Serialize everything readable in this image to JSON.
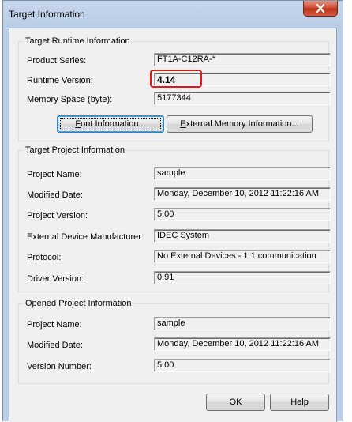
{
  "window": {
    "title": "Target Information",
    "close_glyph": "x"
  },
  "runtime_group": {
    "title": "Target Runtime Information",
    "product_series_label": "Product Series:",
    "product_series_value": "FT1A-C12RA-*",
    "runtime_version_label": "Runtime Version:",
    "runtime_version_value": "4.14",
    "memory_space_label": "Memory Space (byte):",
    "memory_space_value": "5177344",
    "font_button_underline": "F",
    "font_button_rest": "ont Information...",
    "external_memory_button_underline": "E",
    "external_memory_button_rest": "xternal Memory Information..."
  },
  "project_group": {
    "title": "Target Project Information",
    "project_name_label": "Project Name:",
    "project_name_value": "sample",
    "modified_date_label": "Modified Date:",
    "modified_date_value": "Monday, December 10, 2012 11:22:16 AM",
    "project_version_label": "Project Version:",
    "project_version_value": "5.00",
    "manufacturer_label": "External Device Manufacturer:",
    "manufacturer_value": "IDEC System",
    "protocol_label": "Protocol:",
    "protocol_value": "No External Devices - 1:1 communication",
    "driver_version_label": "Driver Version:",
    "driver_version_value": "0.91"
  },
  "opened_group": {
    "title": "Opened Project Information",
    "project_name_label": "Project Name:",
    "project_name_value": "sample",
    "modified_date_label": "Modified Date:",
    "modified_date_value": "Monday, December 10, 2012 11:22:16 AM",
    "version_number_label": "Version Number:",
    "version_number_value": "5.00"
  },
  "footer": {
    "ok_label": "OK",
    "help_label": "Help"
  },
  "colors": {
    "highlight": "#e01818",
    "close_button": "#c8452d"
  },
  "icons": {
    "close": "close-icon"
  }
}
